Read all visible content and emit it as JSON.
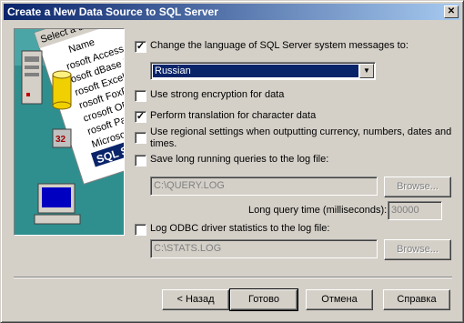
{
  "window": {
    "title": "Create a New Data Source to SQL Server",
    "close_glyph": "✕"
  },
  "illustration": {
    "lines": [
      "Select a driver fo",
      "Name",
      "rosoft Access I",
      "osoft dBase D",
      "rosoft Excel D",
      "rosoft FoxPro",
      "crosoft ODBC",
      "rosoft Parad",
      "Microsoft Tex",
      "SQL Server"
    ],
    "badge": "32"
  },
  "options": {
    "change_language": {
      "label": "Change the language of SQL Server system messages to:",
      "checked": true,
      "glyph": "✓"
    },
    "language_select": {
      "value": "Russian",
      "arrow_glyph": "▼"
    },
    "strong_encryption": {
      "label": "Use strong encryption for data",
      "checked": false
    },
    "perform_translation": {
      "label": "Perform translation for character data",
      "checked": true,
      "glyph": "✓"
    },
    "regional_settings": {
      "line1": "Use regional settings when outputting currency, numbers, dates and",
      "line2": "times.",
      "checked": false
    },
    "save_long_queries": {
      "label": "Save long running queries to the log file:",
      "checked": false
    },
    "query_log_path": "C:\\QUERY.LOG",
    "browse_label_1": "Browse...",
    "long_query_time_label": "Long query time (milliseconds):",
    "long_query_time_value": "30000",
    "log_odbc_stats": {
      "label": "Log ODBC driver statistics to the log file:",
      "checked": false
    },
    "stats_log_path": "C:\\STATS.LOG",
    "browse_label_2": "Browse..."
  },
  "buttons": {
    "back": "< Назад",
    "finish": "Готово",
    "cancel": "Отмена",
    "help": "Справка"
  }
}
